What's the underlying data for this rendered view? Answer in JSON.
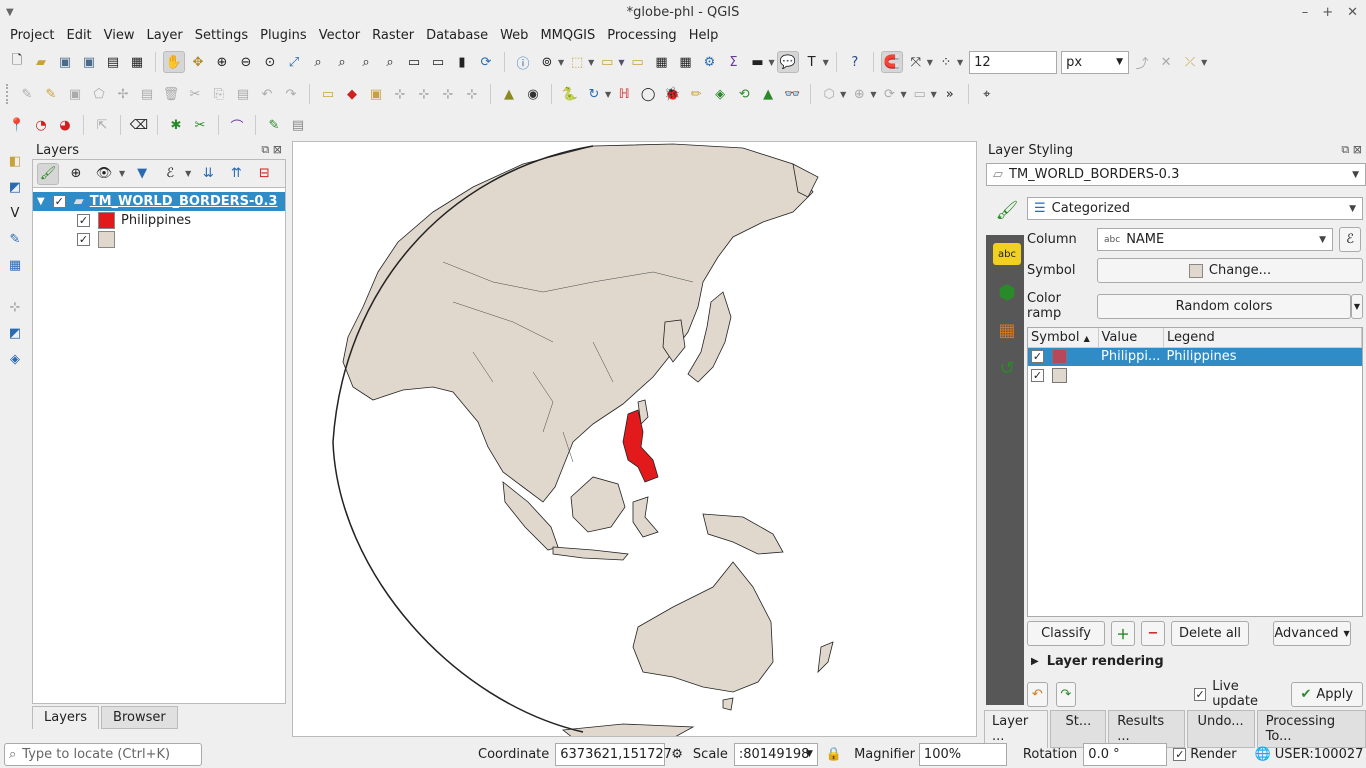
{
  "window": {
    "title": "*globe-phl - QGIS"
  },
  "menus": [
    "Project",
    "Edit",
    "View",
    "Layer",
    "Settings",
    "Plugins",
    "Vector",
    "Raster",
    "Database",
    "Web",
    "MMQGIS",
    "Processing",
    "Help"
  ],
  "toolbar": {
    "snap_tolerance": "12",
    "snap_units": "px"
  },
  "layers_panel": {
    "title": "Layers",
    "group_name": "TM_WORLD_BORDERS-0.3",
    "items": [
      {
        "label": "Philippines",
        "color": "#e31a1c"
      },
      {
        "label": "",
        "color": "#e0d8cc"
      }
    ],
    "tabs": [
      "Layers",
      "Browser"
    ]
  },
  "map": {
    "land_color": "#e0d8cc",
    "highlight_color": "#e31a1c",
    "ocean_color": "#ffffff"
  },
  "styling": {
    "title": "Layer Styling",
    "layer": "TM_WORLD_BORDERS-0.3",
    "renderer": "Categorized",
    "column_label": "Column",
    "column_value": "NAME",
    "column_type": "abc",
    "symbol_label": "Symbol",
    "symbol_button": "Change...",
    "ramp_label": "Color ramp",
    "ramp_value": "Random colors",
    "table_headers": [
      "Symbol",
      "Value",
      "Legend"
    ],
    "rows": [
      {
        "value": "Philippi...",
        "legend": "Philippines",
        "color": "#b7485a",
        "selected": true
      },
      {
        "value": "",
        "legend": "",
        "color": "#e0d8cc",
        "selected": false
      }
    ],
    "classify": "Classify",
    "delete_all": "Delete all",
    "advanced": "Advanced",
    "layer_rendering": "Layer rendering",
    "live_update": "Live update",
    "apply": "Apply",
    "tabs": [
      "Layer ...",
      "St...",
      "Results ...",
      "Undo...",
      "Processing To..."
    ]
  },
  "status": {
    "locate_placeholder": "Type to locate (Ctrl+K)",
    "coordinate_label": "Coordinate",
    "coordinate": "6373621,151727",
    "scale_label": "Scale",
    "scale": ":80149198",
    "magnifier_label": "Magnifier",
    "magnifier": "100%",
    "rotation_label": "Rotation",
    "rotation": "0.0 °",
    "render_label": "Render",
    "crs": "USER:100027"
  }
}
